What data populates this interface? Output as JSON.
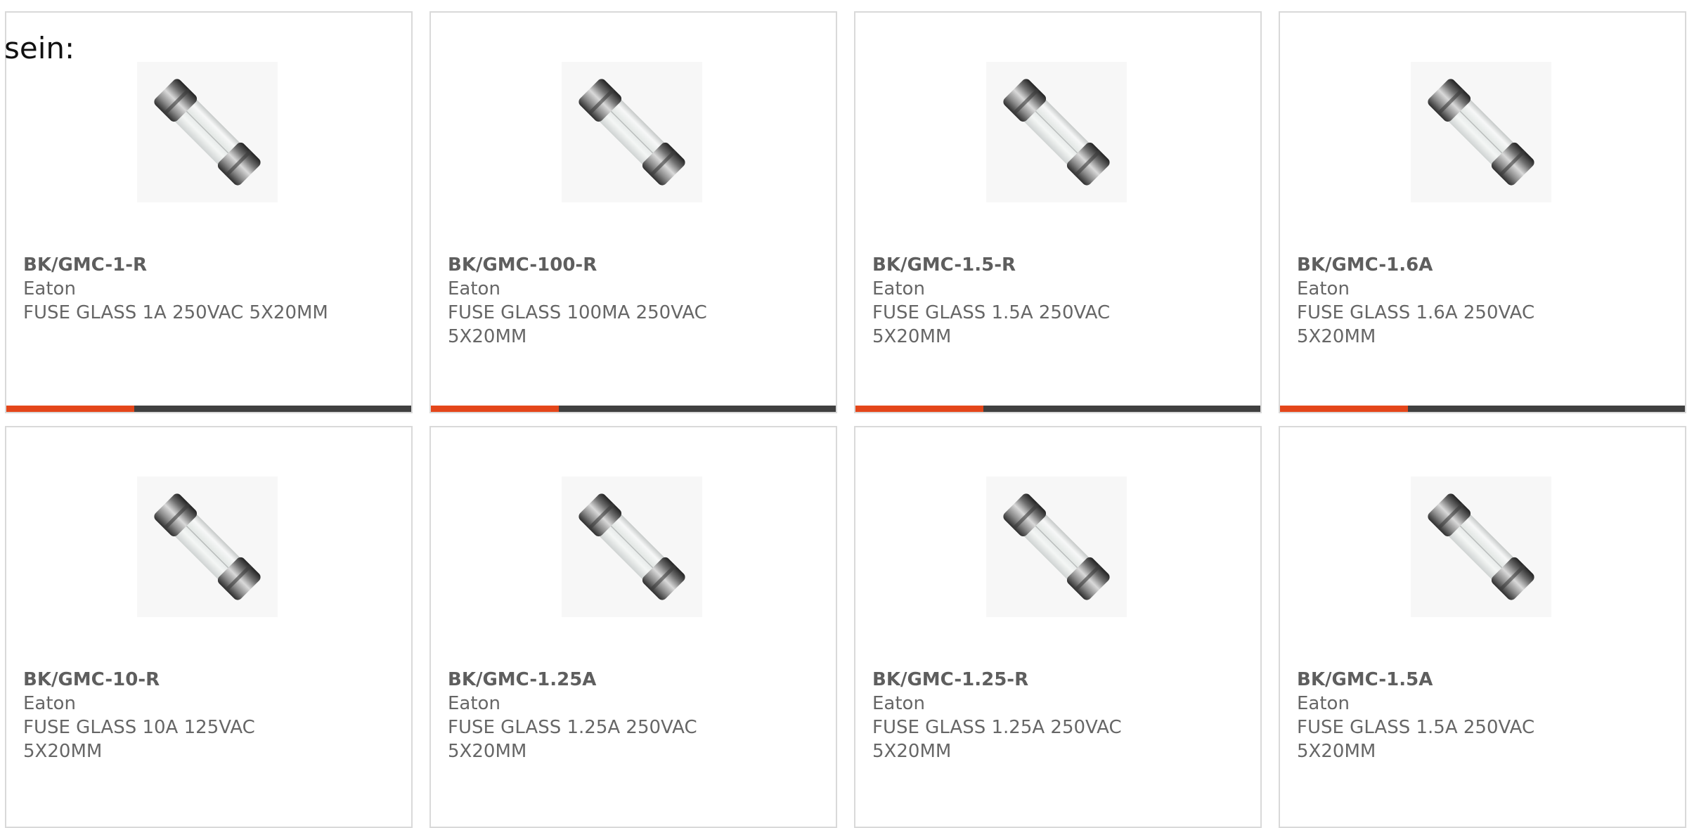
{
  "intro_text": "sein:",
  "colors": {
    "accent": "#e4461a",
    "bar": "#404040",
    "border": "#d9d9d9",
    "text": "#666666"
  },
  "products": [
    {
      "part": "BK/GMC-1-R",
      "maker": "Eaton",
      "desc": "FUSE GLASS 1A 250VAC 5X20MM",
      "image_icon": "glass-fuse-icon"
    },
    {
      "part": "BK/GMC-100-R",
      "maker": "Eaton",
      "desc": "FUSE GLASS 100MA 250VAC 5X20MM",
      "image_icon": "glass-fuse-icon"
    },
    {
      "part": "BK/GMC-1.5-R",
      "maker": "Eaton",
      "desc": "FUSE GLASS 1.5A 250VAC 5X20MM",
      "image_icon": "glass-fuse-icon"
    },
    {
      "part": "BK/GMC-1.6A",
      "maker": "Eaton",
      "desc": "FUSE GLASS 1.6A 250VAC 5X20MM",
      "image_icon": "glass-fuse-icon"
    },
    {
      "part": "BK/GMC-10-R",
      "maker": "Eaton",
      "desc": "FUSE GLASS 10A 125VAC 5X20MM",
      "image_icon": "glass-fuse-icon"
    },
    {
      "part": "BK/GMC-1.25A",
      "maker": "Eaton",
      "desc": "FUSE GLASS 1.25A 250VAC 5X20MM",
      "image_icon": "glass-fuse-icon"
    },
    {
      "part": "BK/GMC-1.25-R",
      "maker": "Eaton",
      "desc": "FUSE GLASS 1.25A 250VAC 5X20MM",
      "image_icon": "glass-fuse-icon"
    },
    {
      "part": "BK/GMC-1.5A",
      "maker": "Eaton",
      "desc": "FUSE GLASS 1.5A 250VAC 5X20MM",
      "image_icon": "glass-fuse-icon"
    }
  ]
}
